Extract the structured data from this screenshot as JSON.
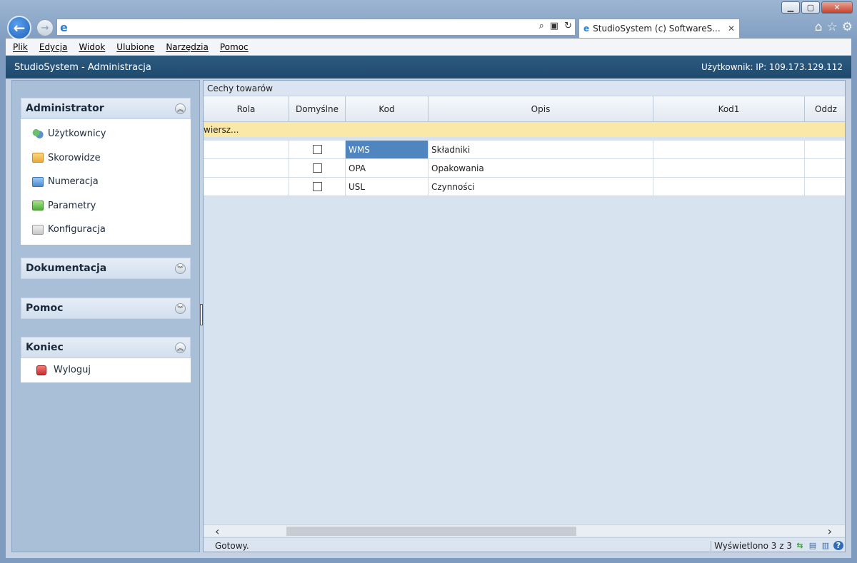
{
  "window": {
    "min_label": "▁",
    "max_label": "▢",
    "close_label": "✕"
  },
  "browser": {
    "back_label": "←",
    "forward_label": "→",
    "address": "",
    "tab_title": "StudioSystem (c) SoftwareS...",
    "tab_close": "✕",
    "toolbar_icons": [
      "home-icon",
      "star-icon",
      "gear-icon"
    ]
  },
  "menu": {
    "items": [
      "Plik",
      "Edycja",
      "Widok",
      "Ulubione",
      "Narzędzia",
      "Pomoc"
    ]
  },
  "app": {
    "title": "StudioSystem - Administracja",
    "user": "Użytkownik: IP: 109.173.129.112"
  },
  "sidebar": {
    "administrator": {
      "title": "Administrator",
      "items": [
        "Użytkownicy",
        "Skorowidze",
        "Numeracja",
        "Parametry",
        "Konfiguracja"
      ]
    },
    "dokumentacja": {
      "title": "Dokumentacja"
    },
    "pomoc": {
      "title": "Pomoc"
    },
    "koniec": {
      "title": "Koniec",
      "items": [
        "Wyloguj"
      ]
    }
  },
  "grid": {
    "title": "Cechy towarów",
    "columns": [
      "Rola",
      "Domyślne",
      "Kod",
      "Opis",
      "Kod1",
      "Oddz"
    ],
    "new_row": "wiersz...",
    "rows": [
      {
        "rola": "",
        "domyslne": false,
        "kod": "WMS",
        "opis": "Składniki",
        "kod1": "",
        "oddz": ""
      },
      {
        "rola": "",
        "domyslne": false,
        "kod": "OPA",
        "opis": "Opakowania",
        "kod1": "",
        "oddz": ""
      },
      {
        "rola": "",
        "domyslne": false,
        "kod": "USL",
        "opis": "Czynności",
        "kod1": "",
        "oddz": ""
      }
    ],
    "selected_row": 0
  },
  "status": {
    "text": "Gotowy.",
    "count": "Wyświetlono 3 z 3"
  },
  "colors": {
    "header": "#1f4a6d",
    "selected": "#4f86bf",
    "new_row": "#fae8a8"
  }
}
